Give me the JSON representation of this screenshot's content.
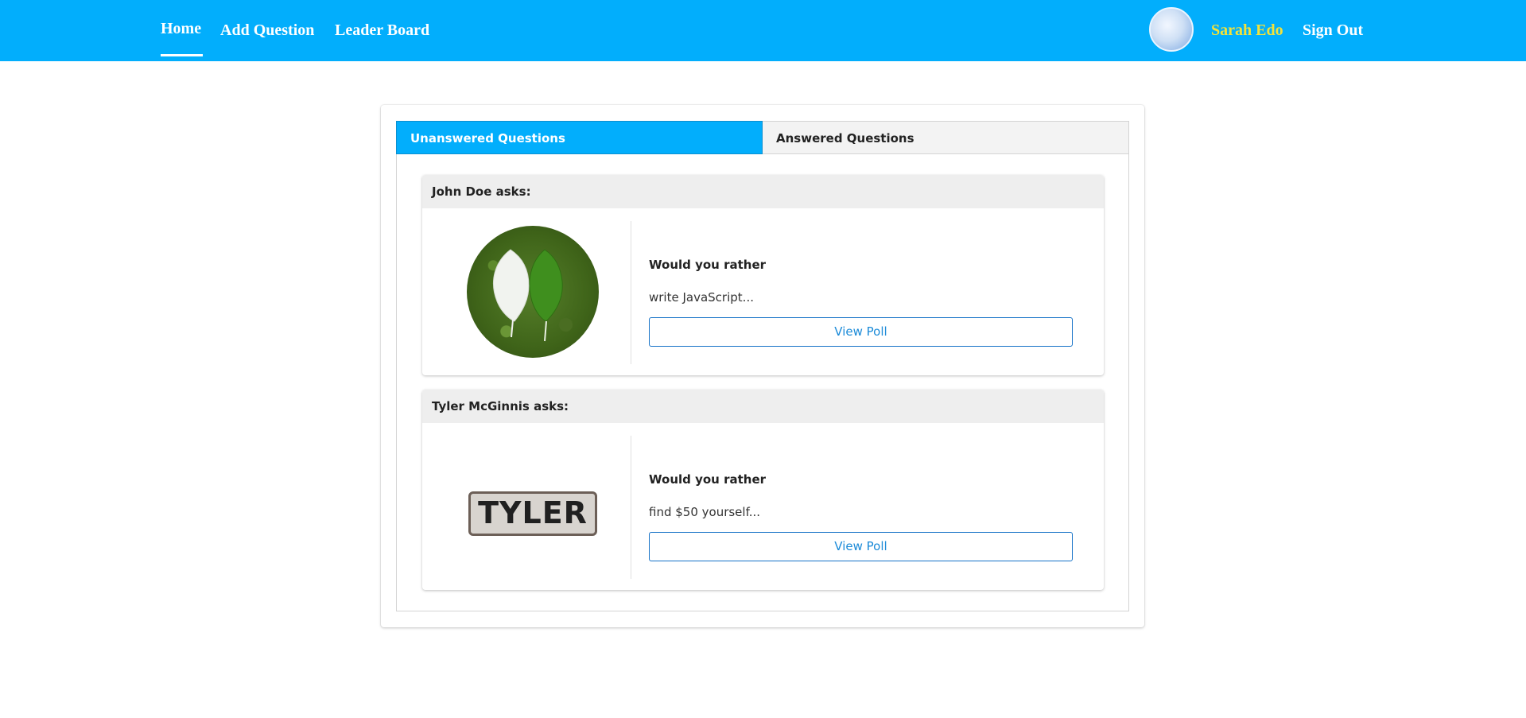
{
  "nav": {
    "home": "Home",
    "add_question": "Add Question",
    "leader_board": "Leader Board",
    "user_name": "Sarah Edo",
    "sign_out": "Sign Out",
    "avatar_icon": "user-avatar-icon",
    "accent_color": "#02aefc",
    "user_color": "#f3e23a"
  },
  "tabs": {
    "unanswered": "Unanswered Questions",
    "answered": "Answered Questions",
    "active": "unanswered"
  },
  "questions": [
    {
      "author_label": "John Doe asks:",
      "title": "Would you rather",
      "option_preview": "write JavaScript...",
      "button": "View Poll",
      "avatar": "leaves-photo"
    },
    {
      "author_label": "Tyler McGinnis asks:",
      "title": "Would you rather",
      "option_preview": "find $50 yourself...",
      "button": "View Poll",
      "avatar": "tyler-sign",
      "avatar_text": "TYLER"
    }
  ]
}
